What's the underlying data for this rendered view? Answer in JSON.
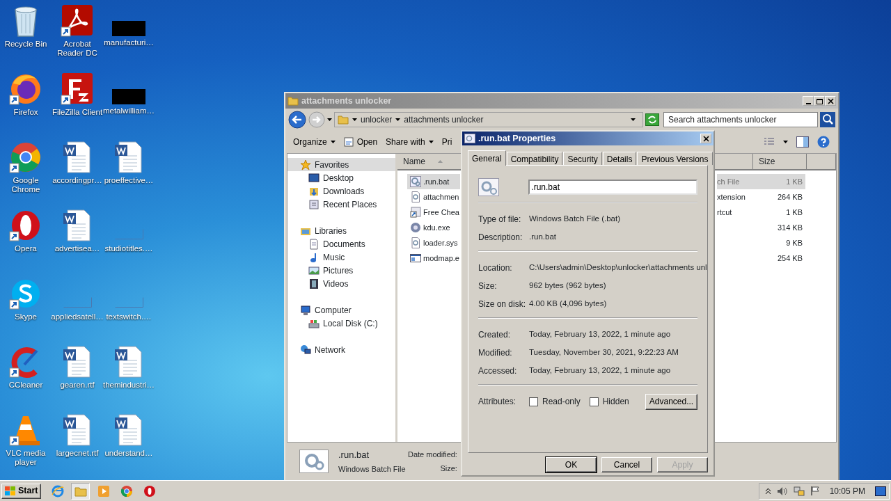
{
  "desktop_icons": [
    {
      "label": "Recycle Bin",
      "kind": "recycle",
      "shortcut": false
    },
    {
      "label": "Acrobat Reader DC",
      "kind": "acrobat",
      "shortcut": true
    },
    {
      "label": "manufacturi…",
      "kind": "redacted",
      "shortcut": false
    },
    {
      "label": "Firefox",
      "kind": "firefox",
      "shortcut": true
    },
    {
      "label": "FileZilla Client",
      "kind": "filezilla",
      "shortcut": true
    },
    {
      "label": "metalwilliam…",
      "kind": "redacted",
      "shortcut": false
    },
    {
      "label": "Google Chrome",
      "kind": "chrome",
      "shortcut": true
    },
    {
      "label": "accordingpr…",
      "kind": "word",
      "shortcut": false
    },
    {
      "label": "proeffective…",
      "kind": "word",
      "shortcut": false
    },
    {
      "label": "Opera",
      "kind": "opera",
      "shortcut": true
    },
    {
      "label": "advertisea…",
      "kind": "word",
      "shortcut": false
    },
    {
      "label": "studiotitles.…",
      "kind": "blank",
      "shortcut": false
    },
    {
      "label": "Skype",
      "kind": "skype",
      "shortcut": true
    },
    {
      "label": "appliedsatell…",
      "kind": "blank",
      "shortcut": false
    },
    {
      "label": "textswitch.…",
      "kind": "blank",
      "shortcut": false
    },
    {
      "label": "CCleaner",
      "kind": "ccleaner",
      "shortcut": true
    },
    {
      "label": "gearen.rtf",
      "kind": "word",
      "shortcut": false
    },
    {
      "label": "themindustri…",
      "kind": "word",
      "shortcut": false
    },
    {
      "label": "VLC media player",
      "kind": "vlc",
      "shortcut": true
    },
    {
      "label": "largecnet.rtf",
      "kind": "word",
      "shortcut": false
    },
    {
      "label": "understand…",
      "kind": "word",
      "shortcut": false
    }
  ],
  "explorer": {
    "title": "attachments unlocker",
    "breadcrumb": [
      "unlocker",
      "attachments unlocker"
    ],
    "search": {
      "placeholder": "Search attachments unlocker"
    },
    "toolbar": [
      {
        "label": "Organize",
        "dropdown": true,
        "kind": "plain"
      },
      {
        "label": "Open",
        "dropdown": false,
        "kind": "open"
      },
      {
        "label": "Share with",
        "dropdown": true,
        "kind": "plain"
      },
      {
        "label": "Pri",
        "dropdown": false,
        "kind": "plain"
      }
    ],
    "nav": [
      {
        "label": "Favorites",
        "kind": "star",
        "selected": true,
        "children": [
          {
            "label": "Desktop",
            "kind": "desktop",
            "selected": false
          },
          {
            "label": "Downloads",
            "kind": "downloads",
            "selected": false
          },
          {
            "label": "Recent Places",
            "kind": "recent",
            "selected": false
          }
        ]
      },
      {
        "label": "Libraries",
        "kind": "libraries",
        "selected": false,
        "children": [
          {
            "label": "Documents",
            "kind": "documents",
            "selected": false
          },
          {
            "label": "Music",
            "kind": "music",
            "selected": false
          },
          {
            "label": "Pictures",
            "kind": "pictures",
            "selected": false
          },
          {
            "label": "Videos",
            "kind": "videos",
            "selected": false
          }
        ]
      },
      {
        "label": "Computer",
        "kind": "computer",
        "selected": false,
        "children": [
          {
            "label": "Local Disk (C:)",
            "kind": "disk",
            "selected": false
          }
        ]
      },
      {
        "label": "Network",
        "kind": "network",
        "selected": false
      }
    ],
    "columns": [
      {
        "label": "Name",
        "sorted": true
      },
      {
        "label": "Size",
        "sorted": false
      }
    ],
    "files": [
      {
        "name": ".run.bat",
        "type": "ch File",
        "size": "1 KB",
        "kind": "batch",
        "selected": true
      },
      {
        "name": "attachmen",
        "type": "xtension",
        "size": "264 KB",
        "kind": "system",
        "selected": false
      },
      {
        "name": "Free Chea",
        "type": "rtcut",
        "size": "1 KB",
        "kind": "shortcut",
        "selected": false
      },
      {
        "name": "kdu.exe",
        "size": "314 KB",
        "kind": "gear",
        "selected": false
      },
      {
        "name": "loader.sys",
        "size": "9 KB",
        "kind": "system",
        "selected": false
      },
      {
        "name": "modmap.e",
        "size": "254 KB",
        "kind": "app",
        "selected": false
      }
    ],
    "details": {
      "name": ".run.bat",
      "type": "Windows Batch File",
      "date_label": "Date modified:",
      "size_label": "Size:"
    }
  },
  "dialog": {
    "title": ".run.bat Properties",
    "tabs": [
      {
        "label": "General",
        "selected": true
      },
      {
        "label": "Compatibility",
        "selected": false
      },
      {
        "label": "Security",
        "selected": false
      },
      {
        "label": "Details",
        "selected": false
      },
      {
        "label": "Previous Versions",
        "selected": false
      }
    ],
    "filename": ".run.bat",
    "sections": [
      [
        {
          "label": "Type of file:",
          "value": "Windows Batch File (.bat)"
        },
        {
          "label": "Description:",
          "value": ".run.bat"
        }
      ],
      [
        {
          "label": "Location:",
          "value": "C:\\Users\\admin\\Desktop\\unlocker\\attachments unl"
        },
        {
          "label": "Size:",
          "value": "962 bytes (962 bytes)"
        },
        {
          "label": "Size on disk:",
          "value": "4.00 KB (4,096 bytes)"
        }
      ],
      [
        {
          "label": "Created:",
          "value": "Today, February 13, 2022, 1 minute ago"
        },
        {
          "label": "Modified:",
          "value": "Tuesday, November 30, 2021, 9:22:23 AM"
        },
        {
          "label": "Accessed:",
          "value": "Today, February 13, 2022, 1 minute ago"
        }
      ]
    ],
    "attributes_label": "Attributes:",
    "attributes": [
      {
        "label": "Read-only",
        "checked": false
      },
      {
        "label": "Hidden",
        "checked": false
      }
    ],
    "advanced": "Advanced...",
    "buttons": [
      {
        "label": "OK",
        "default": true,
        "disabled": false
      },
      {
        "label": "Cancel",
        "default": false,
        "disabled": false
      },
      {
        "label": "Apply",
        "default": false,
        "disabled": true
      }
    ]
  },
  "taskbar": {
    "start": "Start",
    "apps": [
      {
        "kind": "ie",
        "active": false
      },
      {
        "kind": "folder",
        "active": true
      },
      {
        "kind": "media",
        "active": false
      },
      {
        "kind": "chrome",
        "active": false
      },
      {
        "kind": "opera",
        "active": false
      }
    ],
    "clock": "10:05 PM"
  }
}
